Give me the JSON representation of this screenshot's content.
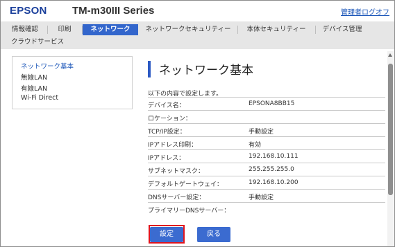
{
  "header": {
    "brand": "EPSON",
    "model": "TM-m30III Series",
    "logout": "管理者ログオフ"
  },
  "tabs": [
    {
      "label": "情報確認"
    },
    {
      "label": "印刷"
    },
    {
      "label": "ネットワーク",
      "active": true
    },
    {
      "label": "ネットワークセキュリティー"
    },
    {
      "label": "本体セキュリティー"
    },
    {
      "label": "デバイス管理"
    },
    {
      "label": "クラウドサービス"
    }
  ],
  "sidenav": {
    "items": [
      {
        "label": "ネットワーク基本",
        "active": true
      },
      {
        "label": "無線LAN"
      },
      {
        "label": "有線LAN"
      },
      {
        "label": "Wi-Fi Direct"
      }
    ]
  },
  "main": {
    "title": "ネットワーク基本",
    "intro": "以下の内容で設定します。",
    "rows": [
      {
        "label": "デバイス名：",
        "value": "EPSONA8BB15"
      },
      {
        "label": "ロケーション：",
        "value": ""
      },
      {
        "label": "TCP/IP設定：",
        "value": "手動設定"
      },
      {
        "label": "IPアドレス印刷：",
        "value": "有効"
      },
      {
        "label": "IPアドレス：",
        "value": "192.168.10.111"
      },
      {
        "label": "サブネットマスク：",
        "value": "255.255.255.0"
      },
      {
        "label": "デフォルトゲートウェイ：",
        "value": "192.168.10.200"
      },
      {
        "label": "DNSサーバー設定：",
        "value": "手動設定"
      },
      {
        "label": "プライマリーDNSサーバー：",
        "value": ""
      }
    ],
    "buttons": {
      "ok": "設定",
      "back": "戻る"
    }
  },
  "colors": {
    "accent": "#3366cc",
    "brand": "#1a3f9b",
    "highlight": "#e0141e"
  }
}
